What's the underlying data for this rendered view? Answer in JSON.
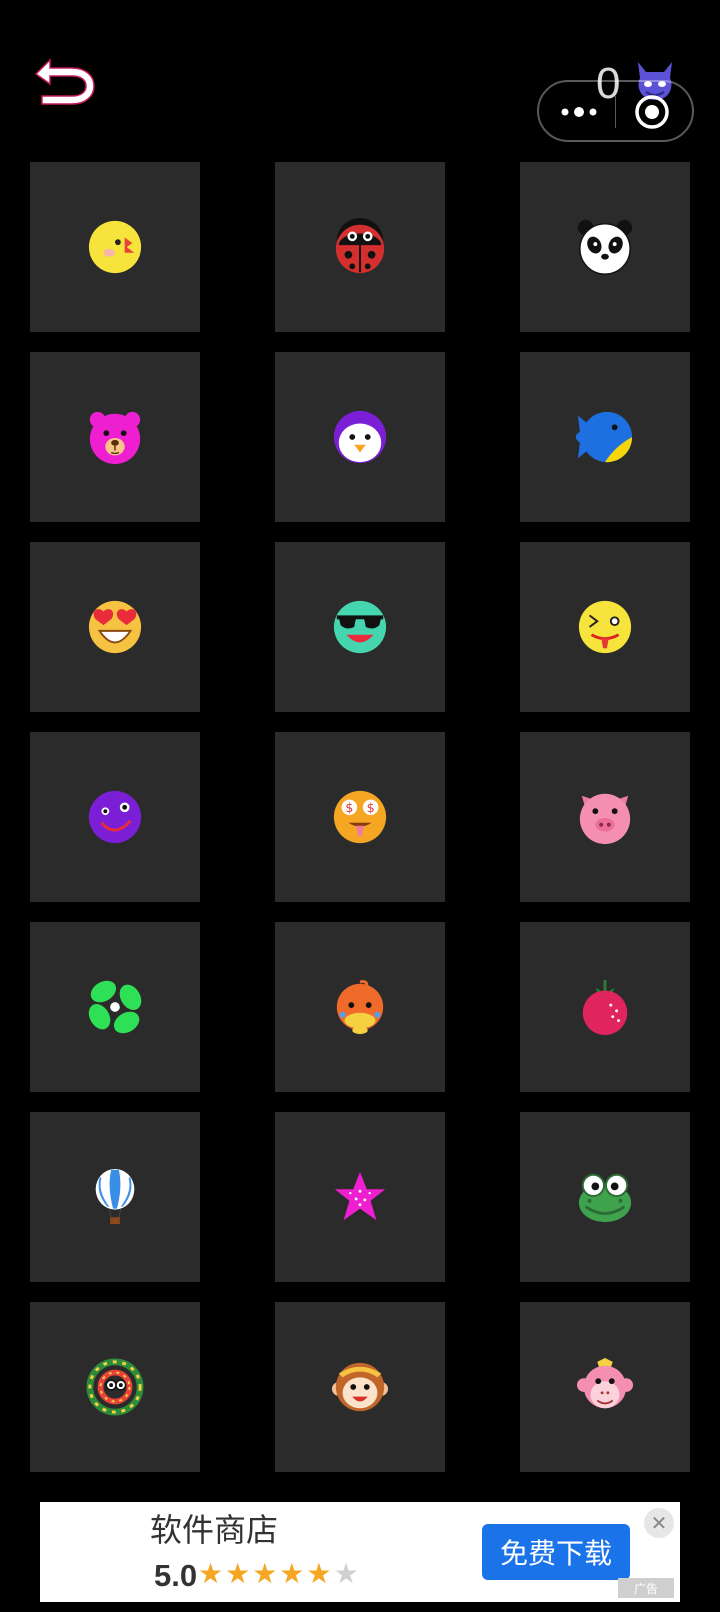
{
  "header": {
    "back_icon": "undo-arrow-icon",
    "score": "0",
    "score_icon": "devil-face-icon",
    "capsule": {
      "more_icon": "more-dots-icon",
      "close_icon": "target-circle-icon"
    }
  },
  "tiles": [
    {
      "icon": "chick-face-icon"
    },
    {
      "icon": "ladybug-icon"
    },
    {
      "icon": "panda-face-icon"
    },
    {
      "icon": "pink-bear-face-icon"
    },
    {
      "icon": "penguin-face-icon"
    },
    {
      "icon": "blue-bird-icon"
    },
    {
      "icon": "heart-eyes-face-icon"
    },
    {
      "icon": "sunglasses-face-icon"
    },
    {
      "icon": "silly-face-icon"
    },
    {
      "icon": "purple-smiley-icon"
    },
    {
      "icon": "money-eyes-face-icon"
    },
    {
      "icon": "pig-face-icon"
    },
    {
      "icon": "green-clover-icon"
    },
    {
      "icon": "orange-duck-icon"
    },
    {
      "icon": "strawberry-icon"
    },
    {
      "icon": "hot-air-balloon-icon"
    },
    {
      "icon": "pink-starfish-icon"
    },
    {
      "icon": "frog-face-icon"
    },
    {
      "icon": "snake-coil-icon"
    },
    {
      "icon": "monkey-king-face-icon"
    },
    {
      "icon": "pink-monkey-face-icon"
    }
  ],
  "ad": {
    "title": "软件商店",
    "rating": "5.0",
    "stars_filled": "★★★★★",
    "stars_empty": "★",
    "button_label": "免费下载",
    "close_label": "✕",
    "tag_label": "广告"
  }
}
